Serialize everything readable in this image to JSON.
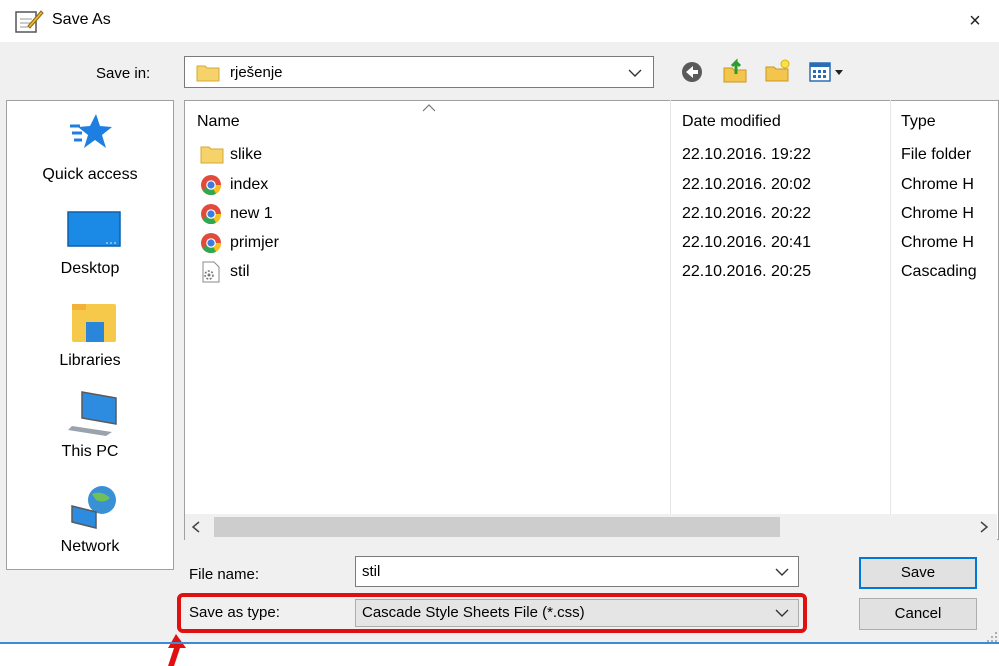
{
  "window": {
    "title": "Save As",
    "close_glyph": "×",
    "icon": "save-as-icon"
  },
  "save_in": {
    "label": "Save in:",
    "value": "rješenje"
  },
  "places": [
    {
      "label": "Quick access",
      "icon": "quick-access-icon"
    },
    {
      "label": "Desktop",
      "icon": "desktop-icon"
    },
    {
      "label": "Libraries",
      "icon": "libraries-icon"
    },
    {
      "label": "This PC",
      "icon": "this-pc-icon"
    },
    {
      "label": "Network",
      "icon": "network-icon"
    }
  ],
  "columns": {
    "name": "Name",
    "date": "Date modified",
    "type": "Type"
  },
  "files": [
    {
      "name": "slike",
      "date": "22.10.2016. 19:22",
      "type": "File folder",
      "icon": "folder-icon"
    },
    {
      "name": "index",
      "date": "22.10.2016. 20:02",
      "type": "Chrome H",
      "icon": "chrome-icon"
    },
    {
      "name": "new 1",
      "date": "22.10.2016. 20:22",
      "type": "Chrome H",
      "icon": "chrome-icon"
    },
    {
      "name": "primjer",
      "date": "22.10.2016. 20:41",
      "type": "Chrome H",
      "icon": "chrome-icon"
    },
    {
      "name": "stil",
      "date": "22.10.2016. 20:25",
      "type": "Cascading",
      "icon": "css-file-icon"
    }
  ],
  "file_name": {
    "label": "File name:",
    "value": "stil"
  },
  "save_type": {
    "label": "Save as type:",
    "value": "Cascade Style Sheets File (*.css)"
  },
  "buttons": {
    "save": "Save",
    "cancel": "Cancel"
  },
  "colors": {
    "accent": "#0078d7",
    "highlight": "#e01010"
  }
}
